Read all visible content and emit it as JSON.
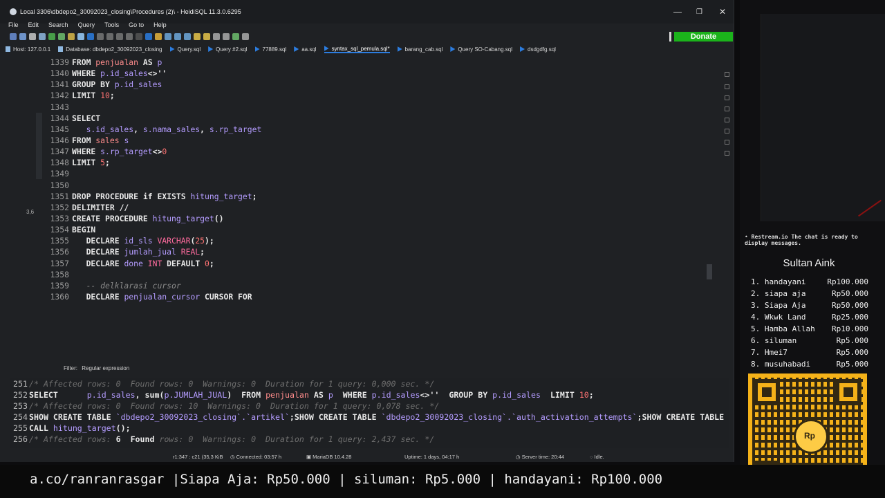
{
  "window": {
    "title": "Local 3306\\dbdepo2_30092023_closing\\Procedures (2)\\ - HeidiSQL 11.3.0.6295",
    "controls": {
      "minimize": "—",
      "maximize": "❐",
      "close": "✕"
    }
  },
  "menu": [
    "File",
    "Edit",
    "Search",
    "Query",
    "Tools",
    "Go to",
    "Help"
  ],
  "donate_label": "Donate",
  "tabs": [
    {
      "label": "Host: 127.0.0.1",
      "icon": "host-icon",
      "color": "#8fb8e0"
    },
    {
      "label": "Database: dbdepo2_30092023_closing",
      "icon": "database-icon",
      "color": "#8fb8e0"
    },
    {
      "label": "Query.sql",
      "icon": "query-icon",
      "color": "#2c7de0"
    },
    {
      "label": "Query #2.sql",
      "icon": "query-icon",
      "color": "#2c7de0"
    },
    {
      "label": "77889.sql",
      "icon": "query-icon",
      "color": "#2c7de0"
    },
    {
      "label": "aa.sql",
      "icon": "query-icon",
      "color": "#2c7de0"
    },
    {
      "label": "syntax_sql_pemula.sql*",
      "icon": "query-icon",
      "color": "#2c7de0",
      "active": true
    },
    {
      "label": "barang_cab.sql",
      "icon": "query-icon",
      "color": "#2c7de0"
    },
    {
      "label": "Query SO-Cabang.sql",
      "icon": "query-icon",
      "color": "#2c7de0"
    },
    {
      "label": "dsdgdfg.sql",
      "icon": "query-icon",
      "color": "#2c7de0"
    }
  ],
  "editor": {
    "gutter_marker": "3,6",
    "lines": [
      {
        "n": "1339",
        "t": [
          [
            "kw",
            "FROM "
          ],
          [
            "tb",
            "penjualan "
          ],
          [
            "kw",
            "AS "
          ],
          [
            "fld",
            "p"
          ]
        ]
      },
      {
        "n": "1340",
        "t": [
          [
            "kw",
            "WHERE "
          ],
          [
            "fld",
            "p.id_sales"
          ],
          [
            "kw",
            "<>''"
          ]
        ]
      },
      {
        "n": "1341",
        "t": [
          [
            "kw",
            "GROUP BY "
          ],
          [
            "fld",
            "p.id_sales"
          ]
        ]
      },
      {
        "n": "1342",
        "t": [
          [
            "kw",
            "LIMIT "
          ],
          [
            "num",
            "10"
          ],
          [
            "kw",
            ";"
          ]
        ]
      },
      {
        "n": "1343",
        "t": []
      },
      {
        "n": "1344",
        "t": [
          [
            "kw",
            "SELECT"
          ]
        ]
      },
      {
        "n": "1345",
        "t": [
          [
            "fld",
            "   s.id_sales"
          ],
          [
            "kw",
            ", "
          ],
          [
            "fld",
            "s.nama_sales"
          ],
          [
            "kw",
            ", "
          ],
          [
            "fld",
            "s.rp_target"
          ]
        ]
      },
      {
        "n": "1346",
        "t": [
          [
            "kw",
            "FROM "
          ],
          [
            "tb",
            "sales "
          ],
          [
            "fld",
            "s"
          ]
        ]
      },
      {
        "n": "1347",
        "t": [
          [
            "kw",
            "WHERE "
          ],
          [
            "fld",
            "s.rp_target"
          ],
          [
            "kw",
            "<>"
          ],
          [
            "num",
            "0"
          ]
        ]
      },
      {
        "n": "1348",
        "t": [
          [
            "kw",
            "LIMIT "
          ],
          [
            "num",
            "5"
          ],
          [
            "kw",
            ";"
          ]
        ]
      },
      {
        "n": "1349",
        "t": []
      },
      {
        "n": "1350",
        "t": []
      },
      {
        "n": "1351",
        "t": [
          [
            "kw",
            "DROP PROCEDURE if EXISTS "
          ],
          [
            "fld",
            "hitung_target"
          ],
          [
            "kw",
            ";"
          ]
        ]
      },
      {
        "n": "1352",
        "t": [
          [
            "kw",
            "DELIMITER //"
          ]
        ]
      },
      {
        "n": "1353",
        "t": [
          [
            "kw",
            "CREATE PROCEDURE "
          ],
          [
            "fld",
            "hitung_target"
          ],
          [
            "kw",
            "()"
          ]
        ]
      },
      {
        "n": "1354",
        "t": [
          [
            "kw",
            "BEGIN"
          ]
        ]
      },
      {
        "n": "1355",
        "t": [
          [
            "kw",
            "   DECLARE "
          ],
          [
            "fld",
            "id_sls "
          ],
          [
            "dt",
            "VARCHAR"
          ],
          [
            "kw",
            "("
          ],
          [
            "num",
            "25"
          ],
          [
            "kw",
            ");"
          ]
        ]
      },
      {
        "n": "1356",
        "t": [
          [
            "kw",
            "   DECLARE "
          ],
          [
            "fld",
            "jumlah_jual "
          ],
          [
            "dt",
            "REAL"
          ],
          [
            "kw",
            ";"
          ]
        ]
      },
      {
        "n": "1357",
        "t": [
          [
            "kw",
            "   DECLARE "
          ],
          [
            "fld",
            "done "
          ],
          [
            "dt",
            "INT "
          ],
          [
            "kw",
            "DEFAULT "
          ],
          [
            "num",
            "0"
          ],
          [
            "kw",
            ";"
          ]
        ]
      },
      {
        "n": "1358",
        "t": []
      },
      {
        "n": "1359",
        "t": [
          [
            "cm",
            "   -- delklarasi cursor"
          ]
        ]
      },
      {
        "n": "1360",
        "t": [
          [
            "kw",
            "   DECLARE "
          ],
          [
            "fld",
            "penjualan_cursor "
          ],
          [
            "kw",
            "CURSOR FOR"
          ]
        ]
      }
    ]
  },
  "filter": {
    "label": "Filter:",
    "placeholder": "Regular expression"
  },
  "log": [
    {
      "n": "251",
      "t": [
        [
          "c",
          "/* Affected rows: 0  Found rows: 0  Warnings: 0  Duration for 1 query: 0,000 sec. */"
        ]
      ]
    },
    {
      "n": "252",
      "t": [
        [
          "kw",
          "SELECT      "
        ],
        [
          "fn",
          "p.id_sales"
        ],
        [
          "kw",
          ", sum("
        ],
        [
          "fn",
          "p.JUMLAH_JUAL"
        ],
        [
          "kw",
          ")  FROM "
        ],
        [
          "tb",
          "penjualan "
        ],
        [
          "kw",
          "AS "
        ],
        [
          "fn",
          "p"
        ],
        [
          "kw",
          "  WHERE "
        ],
        [
          "fn",
          "p.id_sales"
        ],
        [
          "kw",
          "<>''  GROUP BY "
        ],
        [
          "fn",
          "p.id_sales"
        ],
        [
          "kw",
          "  LIMIT "
        ],
        [
          "num",
          "10"
        ],
        [
          "kw",
          ";"
        ]
      ]
    },
    {
      "n": "253",
      "t": [
        [
          "c",
          "/* Affected rows: 0  Found rows: 10  Warnings: 0  Duration for 1 query: 0,078 sec. */"
        ]
      ]
    },
    {
      "n": "254",
      "t": [
        [
          "kw",
          "SHOW CREATE TABLE "
        ],
        [
          "str",
          "`dbdepo2_30092023_closing`.`artikel`"
        ],
        [
          "kw",
          ";SHOW CREATE TABLE "
        ],
        [
          "str",
          "`dbdepo2_30092023_closing`.`auth_activation_attempts`"
        ],
        [
          "kw",
          ";SHOW CREATE TABLE"
        ]
      ]
    },
    {
      "n": "255",
      "t": [
        [
          "kw",
          "CALL "
        ],
        [
          "fn",
          "hitung_target"
        ],
        [
          "kw",
          "();"
        ]
      ]
    },
    {
      "n": "256",
      "t": [
        [
          "c",
          "/* Affected rows: "
        ],
        [
          "kw",
          "6  Found"
        ],
        [
          "c",
          " rows: 0  Warnings: 0  Duration for 1 query: 2,437 sec. */"
        ]
      ]
    }
  ],
  "status": {
    "cursor": "r1:347 : c21 (35,3 KiB",
    "connected": "Connected: 03:57 h",
    "server": "MariaDB 10.4.28",
    "uptime": "Uptime: 1 days, 04:17 h",
    "server_time": "Server time: 20:44",
    "state": "Idle."
  },
  "ticker": "a.co/ranranrasgar |Siapa Aja: Rp50.000 | siluman: Rp5.000 | handayani: Rp100.000",
  "restream": {
    "brand": "Restream.io",
    "message": "The chat is ready to display messages."
  },
  "donors_title": "Sultan Aink",
  "donors": [
    {
      "rank": "1.",
      "name": "handayani",
      "amount": "Rp100.000"
    },
    {
      "rank": "2.",
      "name": "siapa aja",
      "amount": "Rp50.000"
    },
    {
      "rank": "3.",
      "name": "Siapa Aja",
      "amount": "Rp50.000"
    },
    {
      "rank": "4.",
      "name": "Wkwk Land",
      "amount": "Rp25.000"
    },
    {
      "rank": "5.",
      "name": "Hamba Allah",
      "amount": "Rp10.000"
    },
    {
      "rank": "6.",
      "name": "siluman",
      "amount": "Rp5.000"
    },
    {
      "rank": "7.",
      "name": "Hmei7",
      "amount": "Rp5.000"
    },
    {
      "rank": "8.",
      "name": "musuhabadi",
      "amount": "Rp5.000"
    }
  ],
  "colors": {
    "accent": "#2c7de0",
    "donate": "#1bb31b",
    "qr_bg": "#f5b219"
  }
}
